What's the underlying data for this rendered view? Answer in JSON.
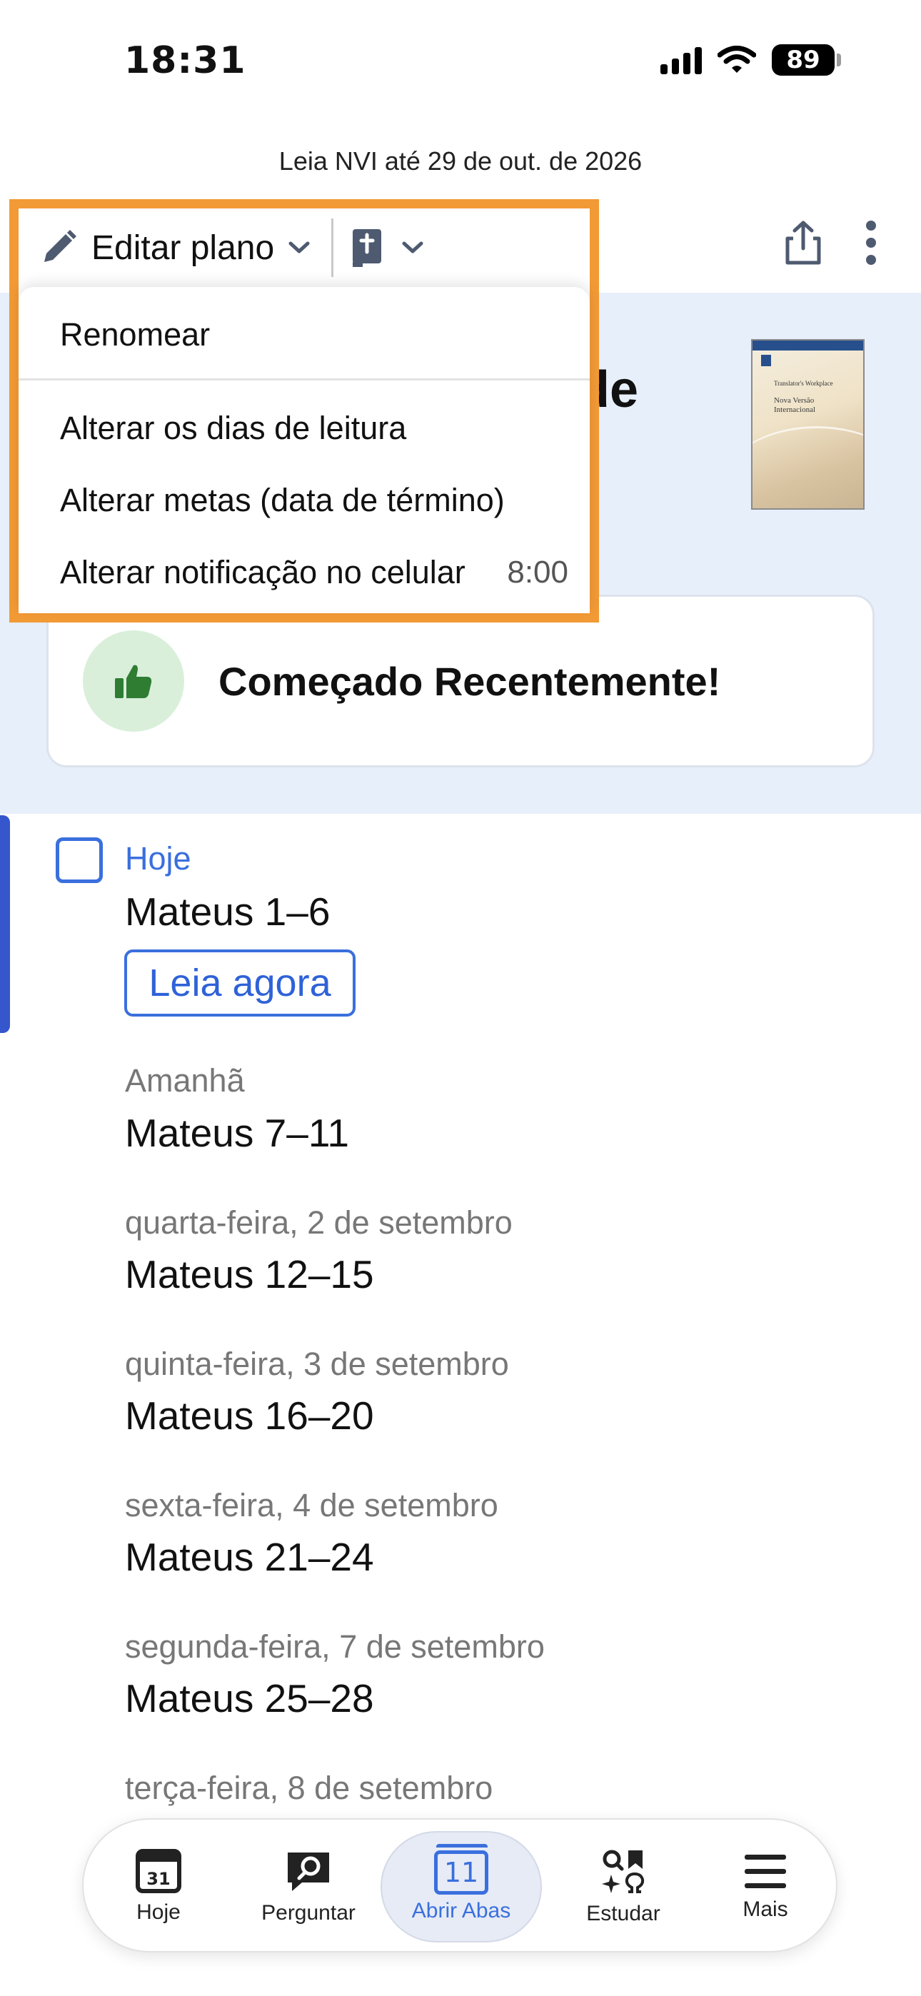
{
  "status_bar": {
    "time": "18:31",
    "battery": "89"
  },
  "plan": {
    "subtitle": "Leia NVI até 29 de out. de 2026"
  },
  "toolbar": {
    "edit_plan_label": "Editar plano"
  },
  "hero": {
    "title_fragment": "de",
    "book_cover": {
      "line1": "Translator's Workplace",
      "line2": "Nova Versão Internacional"
    },
    "status_text": "Começado Recentemente!"
  },
  "menu": {
    "items": [
      {
        "label": "Renomear"
      },
      {
        "label": "Alterar os dias de leitura"
      },
      {
        "label": "Alterar metas (data de término)"
      },
      {
        "label": "Alterar notificação no celular",
        "value": "8:00"
      }
    ]
  },
  "schedule": {
    "read_now_label": "Leia agora",
    "days": [
      {
        "label": "Hoje",
        "reading": "Mateus 1–6"
      },
      {
        "label": "Amanhã",
        "reading": "Mateus 7–11"
      },
      {
        "label": "quarta-feira, 2 de setembro",
        "reading": "Mateus 12–15"
      },
      {
        "label": "quinta-feira, 3 de setembro",
        "reading": "Mateus 16–20"
      },
      {
        "label": "sexta-feira, 4 de setembro",
        "reading": "Mateus 21–24"
      },
      {
        "label": "segunda-feira, 7 de setembro",
        "reading": "Mateus 25–28"
      },
      {
        "label": "terça-feira, 8 de setembro",
        "reading": ""
      }
    ]
  },
  "tabbar": {
    "tabs": [
      {
        "label": "Hoje",
        "icon": "calendar-icon",
        "icon_text": "31"
      },
      {
        "label": "Perguntar",
        "icon": "chat-search-icon"
      },
      {
        "label": "Abrir Abas",
        "icon": "open-tabs-icon",
        "icon_text": "11",
        "active": true
      },
      {
        "label": "Estudar",
        "icon": "study-icon"
      },
      {
        "label": "Mais",
        "icon": "menu-icon"
      }
    ]
  },
  "colors": {
    "accent": "#3a6fdd",
    "highlight_frame": "#f29a35",
    "hero_bg": "#e7effa",
    "success": "#2e7d32"
  }
}
